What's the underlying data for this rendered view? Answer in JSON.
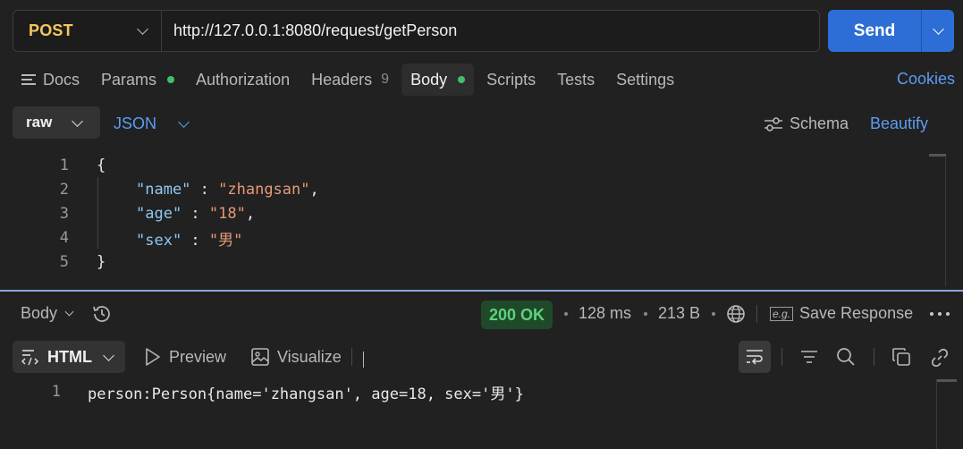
{
  "request": {
    "method": "POST",
    "url": "http://127.0.0.1:8080/request/getPerson",
    "send_label": "Send"
  },
  "tabs": {
    "docs": "Docs",
    "params": "Params",
    "authorization": "Authorization",
    "headers": "Headers",
    "headers_count": "9",
    "body": "Body",
    "scripts": "Scripts",
    "tests": "Tests",
    "settings": "Settings",
    "cookies": "Cookies"
  },
  "body_toolbar": {
    "mode": "raw",
    "format": "JSON",
    "schema": "Schema",
    "beautify": "Beautify"
  },
  "editor": {
    "lines": [
      {
        "n": "1",
        "text": "{"
      },
      {
        "n": "2",
        "key": "\"name\"",
        "sep": " : ",
        "value": "\"zhangsan\"",
        "end": ","
      },
      {
        "n": "3",
        "key": "\"age\"",
        "sep": " : ",
        "value": "\"18\"",
        "end": ","
      },
      {
        "n": "4",
        "key": "\"sex\"",
        "sep": " : ",
        "value": "\"男\"",
        "end": ""
      },
      {
        "n": "5",
        "text": "}"
      }
    ]
  },
  "response": {
    "section_label": "Body",
    "status": "200 OK",
    "time": "128 ms",
    "size": "213 B",
    "save_response": "Save Response",
    "eg_badge": "e.g.",
    "format": "HTML",
    "preview": "Preview",
    "visualize": "Visualize",
    "line_number": "1",
    "line_text": "person:Person{name='zhangsan', age=18, sex='男'}"
  },
  "colors": {
    "accent": "#2c6ed5",
    "link": "#5b9cf2",
    "method": "#f2c85b",
    "status_ok": "#5fd17f"
  }
}
